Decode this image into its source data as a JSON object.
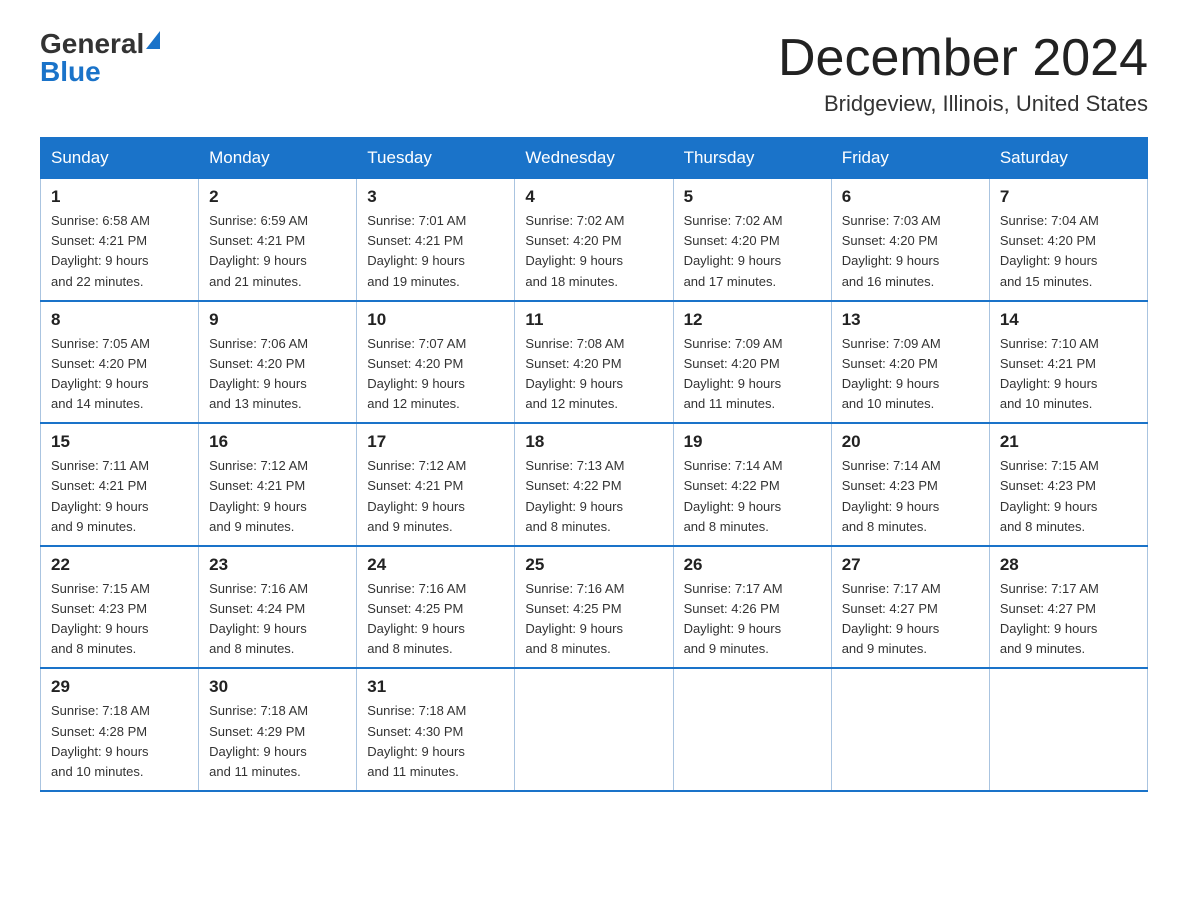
{
  "logo": {
    "general": "General",
    "blue": "Blue"
  },
  "title": "December 2024",
  "subtitle": "Bridgeview, Illinois, United States",
  "days_of_week": [
    "Sunday",
    "Monday",
    "Tuesday",
    "Wednesday",
    "Thursday",
    "Friday",
    "Saturday"
  ],
  "weeks": [
    [
      {
        "day": "1",
        "sunrise": "6:58 AM",
        "sunset": "4:21 PM",
        "daylight": "9 hours and 22 minutes."
      },
      {
        "day": "2",
        "sunrise": "6:59 AM",
        "sunset": "4:21 PM",
        "daylight": "9 hours and 21 minutes."
      },
      {
        "day": "3",
        "sunrise": "7:01 AM",
        "sunset": "4:21 PM",
        "daylight": "9 hours and 19 minutes."
      },
      {
        "day": "4",
        "sunrise": "7:02 AM",
        "sunset": "4:20 PM",
        "daylight": "9 hours and 18 minutes."
      },
      {
        "day": "5",
        "sunrise": "7:02 AM",
        "sunset": "4:20 PM",
        "daylight": "9 hours and 17 minutes."
      },
      {
        "day": "6",
        "sunrise": "7:03 AM",
        "sunset": "4:20 PM",
        "daylight": "9 hours and 16 minutes."
      },
      {
        "day": "7",
        "sunrise": "7:04 AM",
        "sunset": "4:20 PM",
        "daylight": "9 hours and 15 minutes."
      }
    ],
    [
      {
        "day": "8",
        "sunrise": "7:05 AM",
        "sunset": "4:20 PM",
        "daylight": "9 hours and 14 minutes."
      },
      {
        "day": "9",
        "sunrise": "7:06 AM",
        "sunset": "4:20 PM",
        "daylight": "9 hours and 13 minutes."
      },
      {
        "day": "10",
        "sunrise": "7:07 AM",
        "sunset": "4:20 PM",
        "daylight": "9 hours and 12 minutes."
      },
      {
        "day": "11",
        "sunrise": "7:08 AM",
        "sunset": "4:20 PM",
        "daylight": "9 hours and 12 minutes."
      },
      {
        "day": "12",
        "sunrise": "7:09 AM",
        "sunset": "4:20 PM",
        "daylight": "9 hours and 11 minutes."
      },
      {
        "day": "13",
        "sunrise": "7:09 AM",
        "sunset": "4:20 PM",
        "daylight": "9 hours and 10 minutes."
      },
      {
        "day": "14",
        "sunrise": "7:10 AM",
        "sunset": "4:21 PM",
        "daylight": "9 hours and 10 minutes."
      }
    ],
    [
      {
        "day": "15",
        "sunrise": "7:11 AM",
        "sunset": "4:21 PM",
        "daylight": "9 hours and 9 minutes."
      },
      {
        "day": "16",
        "sunrise": "7:12 AM",
        "sunset": "4:21 PM",
        "daylight": "9 hours and 9 minutes."
      },
      {
        "day": "17",
        "sunrise": "7:12 AM",
        "sunset": "4:21 PM",
        "daylight": "9 hours and 9 minutes."
      },
      {
        "day": "18",
        "sunrise": "7:13 AM",
        "sunset": "4:22 PM",
        "daylight": "9 hours and 8 minutes."
      },
      {
        "day": "19",
        "sunrise": "7:14 AM",
        "sunset": "4:22 PM",
        "daylight": "9 hours and 8 minutes."
      },
      {
        "day": "20",
        "sunrise": "7:14 AM",
        "sunset": "4:23 PM",
        "daylight": "9 hours and 8 minutes."
      },
      {
        "day": "21",
        "sunrise": "7:15 AM",
        "sunset": "4:23 PM",
        "daylight": "9 hours and 8 minutes."
      }
    ],
    [
      {
        "day": "22",
        "sunrise": "7:15 AM",
        "sunset": "4:23 PM",
        "daylight": "9 hours and 8 minutes."
      },
      {
        "day": "23",
        "sunrise": "7:16 AM",
        "sunset": "4:24 PM",
        "daylight": "9 hours and 8 minutes."
      },
      {
        "day": "24",
        "sunrise": "7:16 AM",
        "sunset": "4:25 PM",
        "daylight": "9 hours and 8 minutes."
      },
      {
        "day": "25",
        "sunrise": "7:16 AM",
        "sunset": "4:25 PM",
        "daylight": "9 hours and 8 minutes."
      },
      {
        "day": "26",
        "sunrise": "7:17 AM",
        "sunset": "4:26 PM",
        "daylight": "9 hours and 9 minutes."
      },
      {
        "day": "27",
        "sunrise": "7:17 AM",
        "sunset": "4:27 PM",
        "daylight": "9 hours and 9 minutes."
      },
      {
        "day": "28",
        "sunrise": "7:17 AM",
        "sunset": "4:27 PM",
        "daylight": "9 hours and 9 minutes."
      }
    ],
    [
      {
        "day": "29",
        "sunrise": "7:18 AM",
        "sunset": "4:28 PM",
        "daylight": "9 hours and 10 minutes."
      },
      {
        "day": "30",
        "sunrise": "7:18 AM",
        "sunset": "4:29 PM",
        "daylight": "9 hours and 11 minutes."
      },
      {
        "day": "31",
        "sunrise": "7:18 AM",
        "sunset": "4:30 PM",
        "daylight": "9 hours and 11 minutes."
      },
      null,
      null,
      null,
      null
    ]
  ],
  "labels": {
    "sunrise": "Sunrise:",
    "sunset": "Sunset:",
    "daylight": "Daylight:"
  }
}
